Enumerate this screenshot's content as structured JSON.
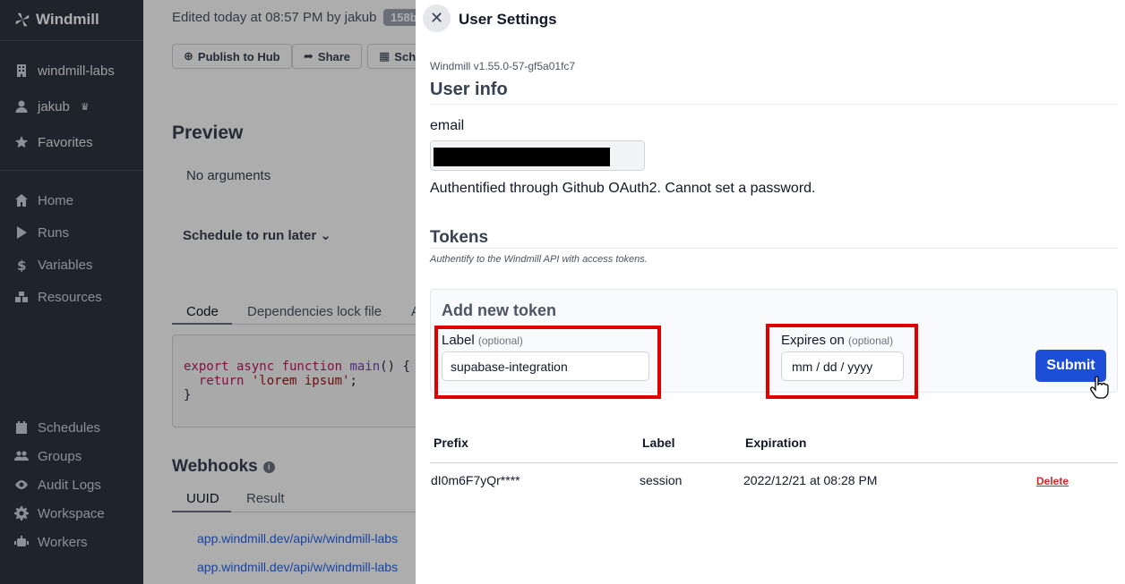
{
  "sidebar": {
    "brand": "Windmill",
    "workspace": "windmill-labs",
    "user": "jakub",
    "user_badge": "♛",
    "favorites": "Favorites",
    "nav": [
      "Home",
      "Runs",
      "Variables",
      "Resources"
    ],
    "bottom_nav": [
      "Schedules",
      "Groups",
      "Audit Logs",
      "Workspace",
      "Workers"
    ]
  },
  "main": {
    "edited": "Edited today at 08:57 PM by jakub",
    "version_badge": "158b",
    "buttons": [
      "Publish to Hub",
      "Share",
      "Sche"
    ],
    "preview_title": "Preview",
    "no_args": "No arguments",
    "schedule_later": "Schedule to run later",
    "code_tabs": [
      "Code",
      "Dependencies lock file",
      "A"
    ],
    "code_lines": {
      "l1_kw": "export async function",
      "l1_fn": "main",
      "l1_rest": "() {",
      "l2_kw": "return",
      "l2_str": "'lorem ipsum'",
      "l2_end": ";",
      "l3": "}"
    },
    "webhooks_title": "Webhooks",
    "webhook_tabs": [
      "UUID",
      "Result"
    ],
    "webhook_links": [
      "app.windmill.dev/api/w/windmill-labs",
      "app.windmill.dev/api/w/windmill-labs"
    ]
  },
  "drawer": {
    "title": "User Settings",
    "version": "Windmill v1.55.0-57-gf5a01fc7",
    "user_info_title": "User info",
    "email_label": "email",
    "auth_text": "Authentified through Github OAuth2. Cannot set a password.",
    "tokens_title": "Tokens",
    "tokens_subtitle": "Authentify to the Windmill API with access tokens.",
    "new_token": {
      "title": "Add new token",
      "label_label": "Label",
      "label_optional": "(optional)",
      "label_value": "supabase-integration",
      "expires_label": "Expires on",
      "expires_optional": "(optional)",
      "expires_placeholder": "mm / dd / yyyy",
      "submit": "Submit"
    },
    "table": {
      "headers": [
        "Prefix",
        "Label",
        "Expiration"
      ],
      "rows": [
        {
          "prefix": "dI0m6F7yQr****",
          "label": "session",
          "expiration": "2022/12/21 at 08:28 PM",
          "action": "Delete"
        }
      ]
    }
  },
  "colors": {
    "sidebar_bg": "#2e3440",
    "accent": "#1d4ed8",
    "highlight": "#e00000",
    "danger": "#dc2626"
  }
}
